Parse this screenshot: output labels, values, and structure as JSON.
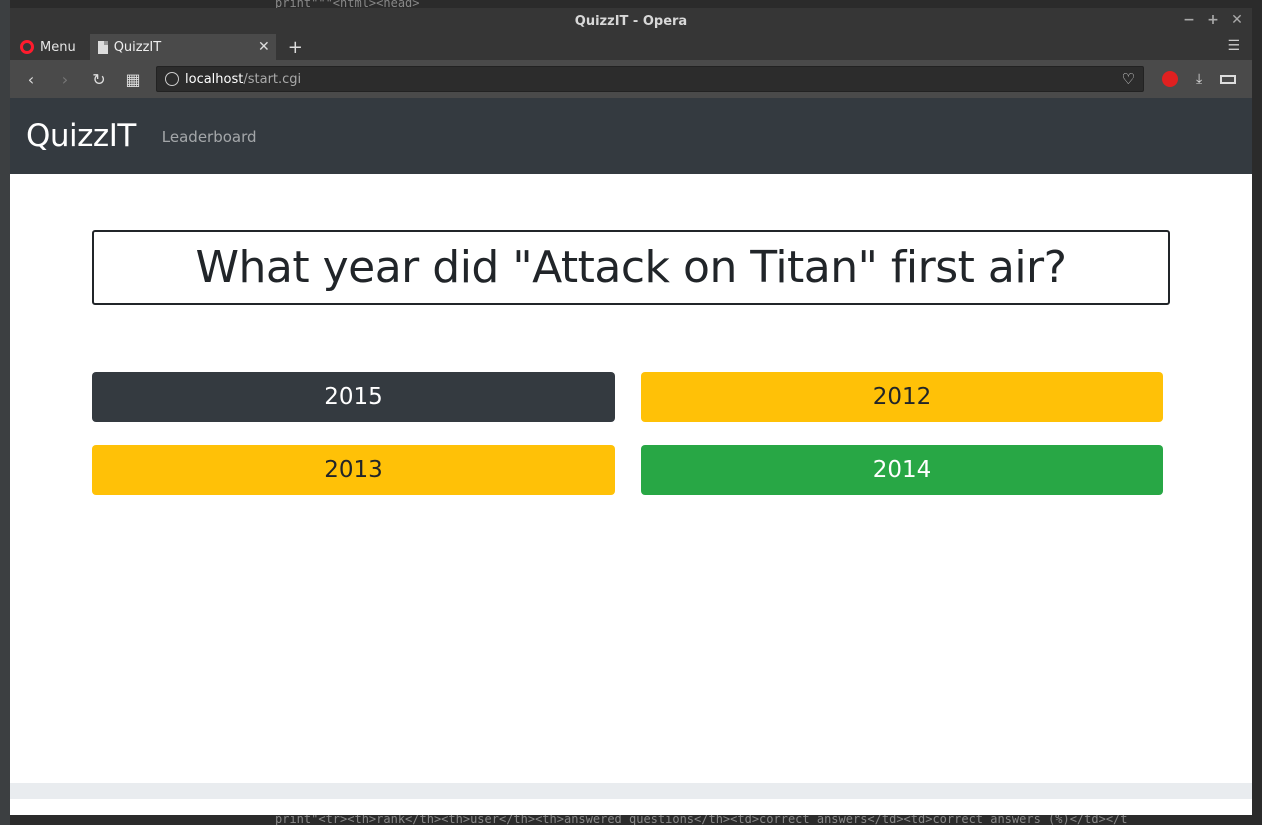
{
  "background_code": {
    "top_line": "print\"\"\"<html><head>",
    "bottom_line": "print\"<tr><th>rank</th><th>user</th><th>answered questions</th><td>correct answers</td><td>correct answers (%)</td></t"
  },
  "window": {
    "title": "QuizzIT - Opera"
  },
  "browser": {
    "menu_label": "Menu",
    "tab_title": "QuizzIT",
    "url_host": "localhost",
    "url_path": "/start.cgi"
  },
  "page": {
    "brand": "QuizzIT",
    "nav_leaderboard": "Leaderboard",
    "question": "What year did \"Attack on Titan\" first air?",
    "answers": [
      {
        "label": "2015",
        "color": "#343a40"
      },
      {
        "label": "2012",
        "color": "#ffc107"
      },
      {
        "label": "2013",
        "color": "#ffc107"
      },
      {
        "label": "2014",
        "color": "#28a745"
      }
    ]
  }
}
